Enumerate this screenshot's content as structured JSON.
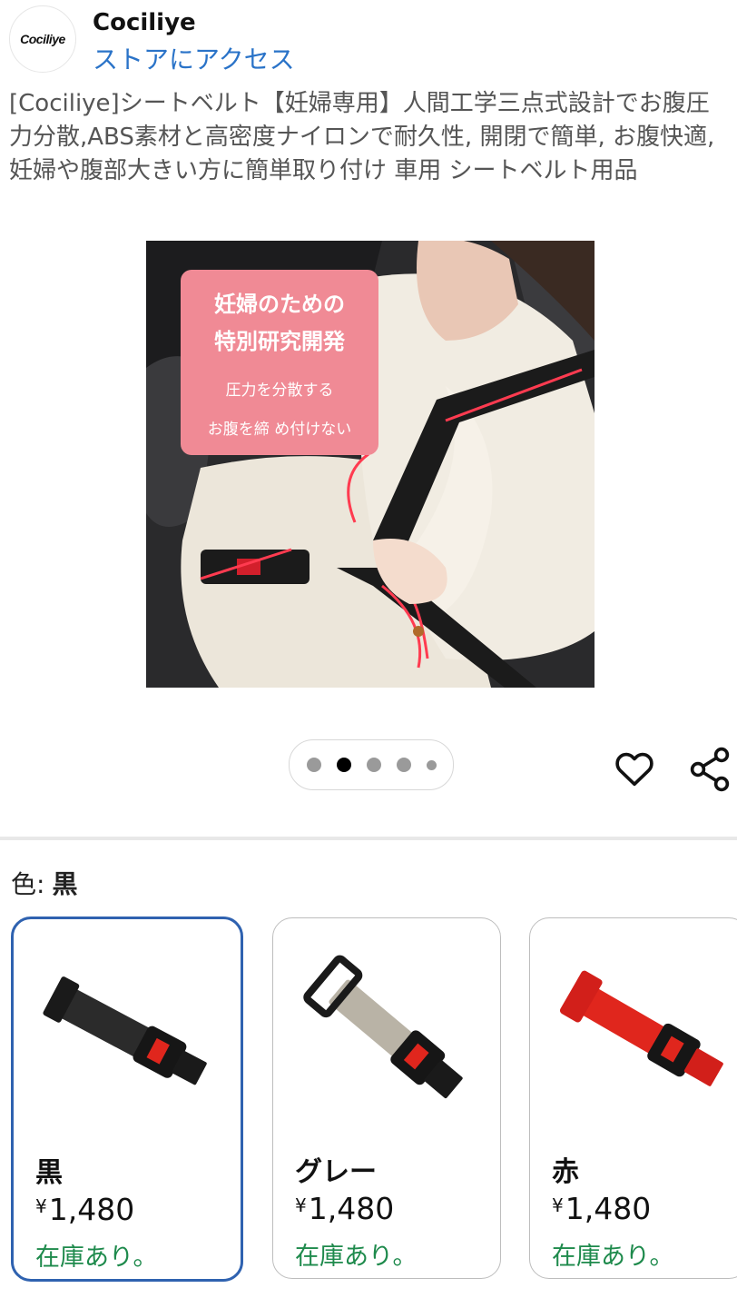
{
  "store": {
    "logo_text": "Cociliye",
    "name": "Cociliye",
    "link_label": "ストアにアクセス"
  },
  "product": {
    "title": "[Cociliye]シートベルト【妊婦専用】人間工学三点式設計でお腹圧力分散,ABS素材と高密度ナイロンで耐久性, 開閉で簡単, お腹快適, 妊婦や腹部大きい方に簡単取り付け 車用 シートベルト用品"
  },
  "hero": {
    "callout_line1": "妊婦のための",
    "callout_line2": "特別研究開発",
    "callout_line3": "圧力を分散する",
    "callout_line4": "お腹を締 め付けない",
    "callout_color": "#f08a95"
  },
  "pager": {
    "count": 5,
    "active_index": 1
  },
  "icons": {
    "favorite": "heart-icon",
    "share": "share-icon"
  },
  "variation": {
    "label": "色:",
    "selected": "黒",
    "options": [
      {
        "name": "黒",
        "currency": "¥",
        "price": "1,480",
        "stock": "在庫あり。",
        "strap_color": "#2b2b2b"
      },
      {
        "name": "グレー",
        "currency": "¥",
        "price": "1,480",
        "stock": "在庫あり。",
        "strap_color": "#b9b3a6"
      },
      {
        "name": "赤",
        "currency": "¥",
        "price": "1,480",
        "stock": "在庫あり。",
        "strap_color": "#e0261d"
      }
    ]
  },
  "colors": {
    "link": "#2a73c8",
    "selected_border": "#2f62b0",
    "in_stock": "#1e8a4c"
  }
}
